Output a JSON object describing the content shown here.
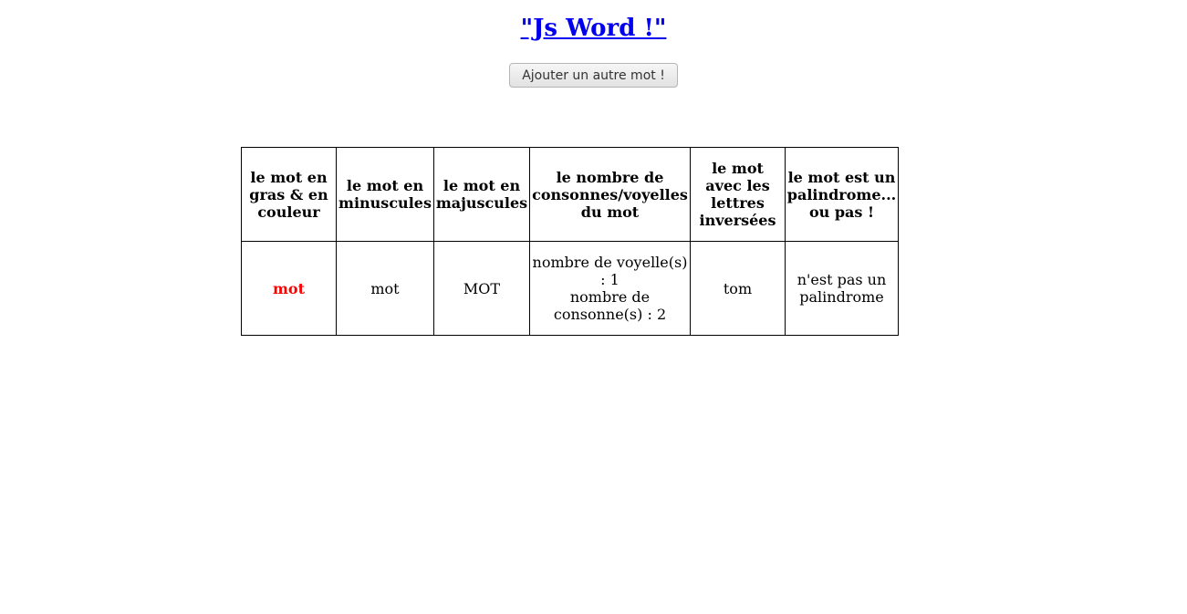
{
  "page": {
    "title": "\"Js Word !\"",
    "add_button_label": "Ajouter un autre mot !"
  },
  "table": {
    "headers": [
      "le mot en gras & en couleur",
      "le mot en minuscules",
      "le mot en majuscules",
      "le nombre de consonnes/voyelles du mot",
      "le mot avec les lettres inversées",
      "le mot est un palindrome... ou pas !"
    ],
    "rows": [
      {
        "bold_colored": "mot",
        "lowercase": "mot",
        "uppercase": "MOT",
        "vowels_text": "nombre de voyelle(s) : 1",
        "consonants_text": "nombre de consonne(s) : 2",
        "reversed": "tom",
        "palindrome": "n'est pas un palindrome"
      }
    ]
  },
  "colors": {
    "link": "#0000ee",
    "highlight_word": "#ff0000"
  }
}
